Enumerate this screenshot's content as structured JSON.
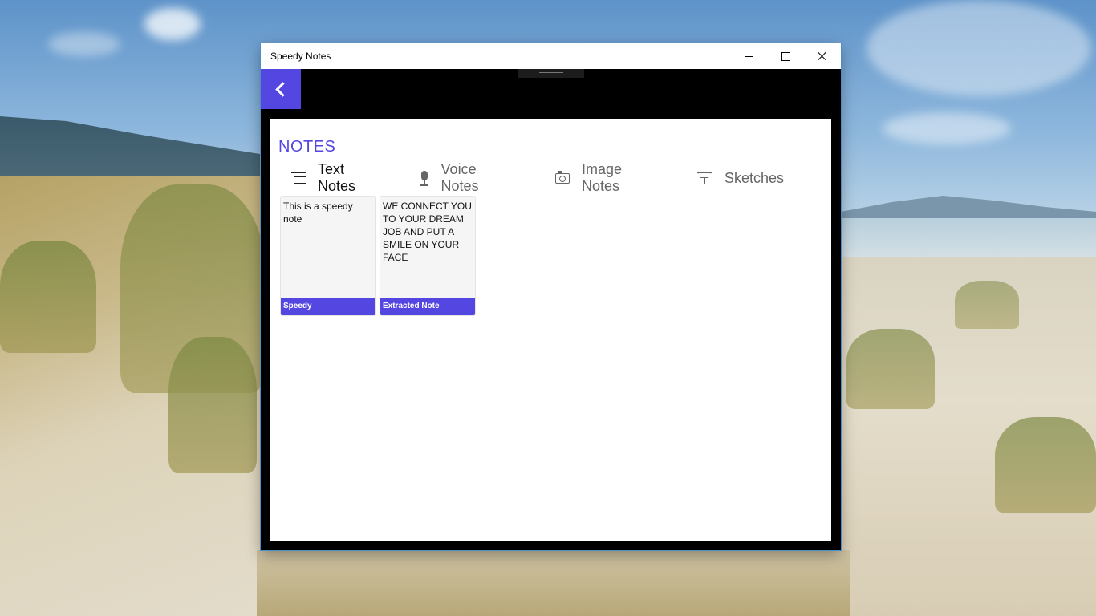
{
  "window": {
    "title": "Speedy Notes",
    "controls": {
      "minimize": "minimize-icon",
      "maximize": "maximize-icon",
      "close": "close-icon"
    }
  },
  "nav": {
    "back_icon": "chevron-left-icon"
  },
  "main": {
    "heading": "NOTES",
    "tabs": [
      {
        "label": "Text Notes",
        "icon": "lines-icon",
        "active": true
      },
      {
        "label": "Voice Notes",
        "icon": "microphone-icon",
        "active": false
      },
      {
        "label": "Image Notes",
        "icon": "camera-icon",
        "active": false
      },
      {
        "label": "Sketches",
        "icon": "brush-icon",
        "active": false
      }
    ],
    "notes": [
      {
        "body": "This is a speedy note",
        "title": "Speedy"
      },
      {
        "body": "WE CONNECT YOU TO YOUR DREAM JOB AND PUT A SMILE ON YOUR FACE",
        "title": "Extracted Note"
      }
    ]
  },
  "colors": {
    "accent": "#5446e0",
    "window_background": "#000000",
    "panel_background": "#ffffff"
  }
}
